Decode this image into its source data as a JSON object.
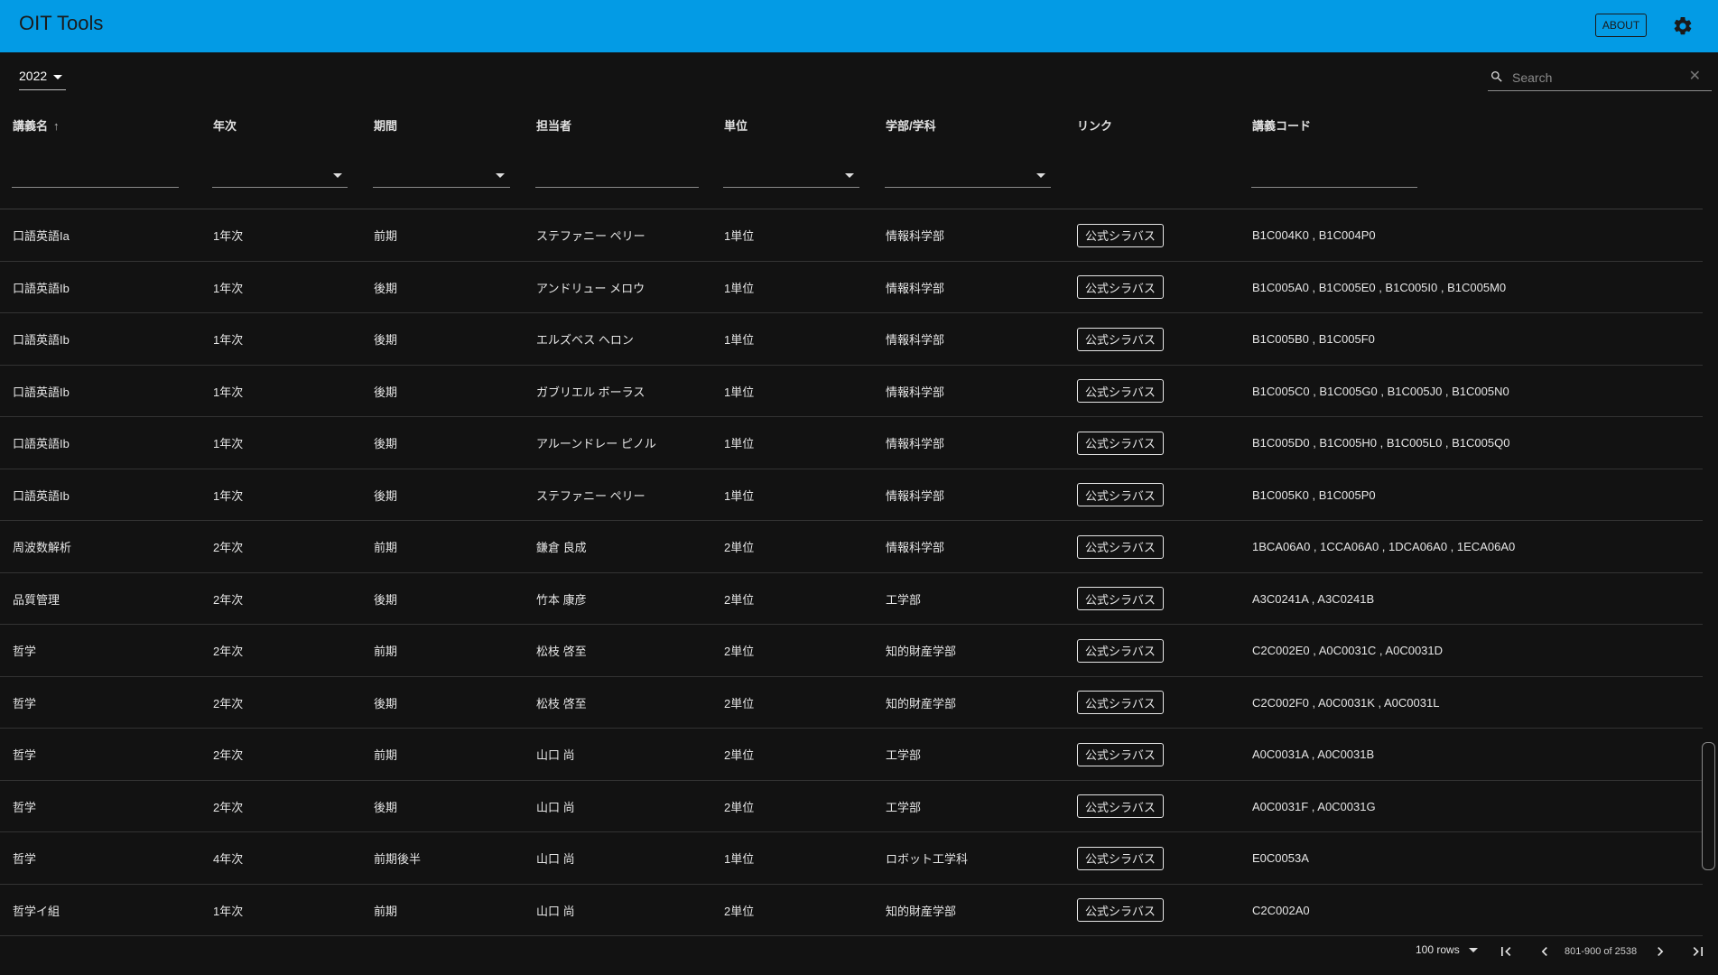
{
  "app": {
    "title": "OIT Tools",
    "about_label": "ABOUT"
  },
  "toolbar": {
    "year": "2022",
    "search_placeholder": "Search"
  },
  "table": {
    "columns": [
      "講義名",
      "年次",
      "期間",
      "担当者",
      "単位",
      "学部/学科",
      "リンク",
      "講義コード"
    ],
    "sort": {
      "column": "講義名",
      "direction": "ascending"
    },
    "rows": [
      [
        "口語英語Ia",
        "1年次",
        "前期",
        "ステファニー ペリー",
        "1単位",
        "情報科学部",
        "公式シラバス",
        "B1C004K0 , B1C004P0"
      ],
      [
        "口語英語Ib",
        "1年次",
        "後期",
        "アンドリュー メロウ",
        "1単位",
        "情報科学部",
        "公式シラバス",
        "B1C005A0 , B1C005E0 , B1C005I0 , B1C005M0"
      ],
      [
        "口語英語Ib",
        "1年次",
        "後期",
        "エルズベス ヘロン",
        "1単位",
        "情報科学部",
        "公式シラバス",
        "B1C005B0 , B1C005F0"
      ],
      [
        "口語英語Ib",
        "1年次",
        "後期",
        "ガブリエル ボーラス",
        "1単位",
        "情報科学部",
        "公式シラバス",
        "B1C005C0 , B1C005G0 , B1C005J0 , B1C005N0"
      ],
      [
        "口語英語Ib",
        "1年次",
        "後期",
        "アルーンドレー ピノル",
        "1単位",
        "情報科学部",
        "公式シラバス",
        "B1C005D0 , B1C005H0 , B1C005L0 , B1C005Q0"
      ],
      [
        "口語英語Ib",
        "1年次",
        "後期",
        "ステファニー ペリー",
        "1単位",
        "情報科学部",
        "公式シラバス",
        "B1C005K0 , B1C005P0"
      ],
      [
        "周波数解析",
        "2年次",
        "前期",
        "鎌倉 良成",
        "2単位",
        "情報科学部",
        "公式シラバス",
        "1BCA06A0 , 1CCA06A0 , 1DCA06A0 , 1ECA06A0"
      ],
      [
        "品質管理",
        "2年次",
        "後期",
        "竹本 康彦",
        "2単位",
        "工学部",
        "公式シラバス",
        "A3C0241A , A3C0241B"
      ],
      [
        "哲学",
        "2年次",
        "前期",
        "松枝 啓至",
        "2単位",
        "知的財産学部",
        "公式シラバス",
        "C2C002E0 , A0C0031C , A0C0031D"
      ],
      [
        "哲学",
        "2年次",
        "後期",
        "松枝 啓至",
        "2単位",
        "知的財産学部",
        "公式シラバス",
        "C2C002F0 , A0C0031K , A0C0031L"
      ],
      [
        "哲学",
        "2年次",
        "前期",
        "山口 尚",
        "2単位",
        "工学部",
        "公式シラバス",
        "A0C0031A , A0C0031B"
      ],
      [
        "哲学",
        "2年次",
        "後期",
        "山口 尚",
        "2単位",
        "工学部",
        "公式シラバス",
        "A0C0031F , A0C0031G"
      ],
      [
        "哲学",
        "4年次",
        "前期後半",
        "山口 尚",
        "1単位",
        "ロボット工学科",
        "公式シラバス",
        "E0C0053A"
      ],
      [
        "哲学イ組",
        "1年次",
        "前期",
        "山口 尚",
        "2単位",
        "知的財産学部",
        "公式シラバス",
        "C2C002A0"
      ]
    ]
  },
  "pagination": {
    "rows_per_page": "100 rows",
    "range": "801-900 of 2538"
  },
  "colors": {
    "appbar": "#039be5",
    "background": "#121212"
  }
}
